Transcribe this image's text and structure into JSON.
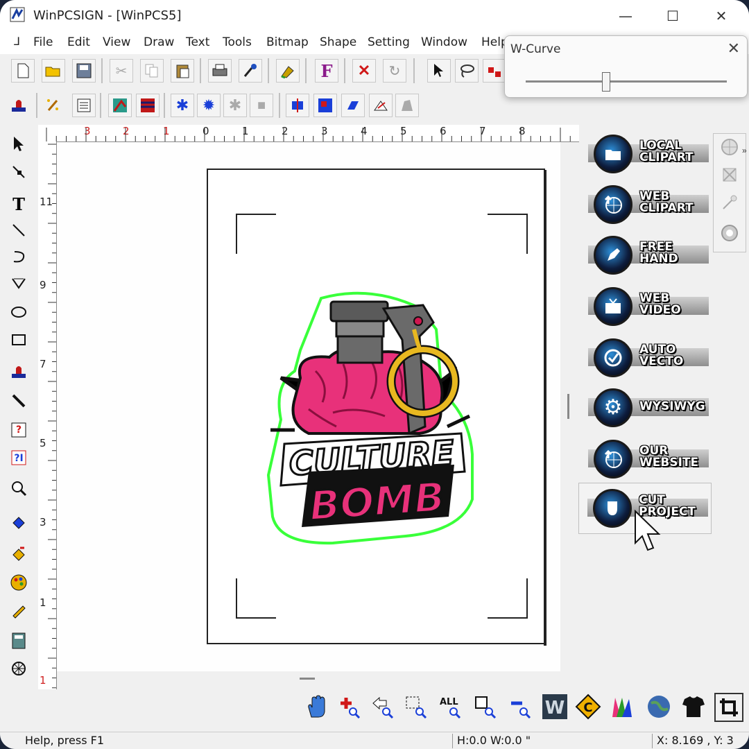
{
  "window": {
    "title": "WinPCSIGN - [WinPCS5]",
    "controls": {
      "minimize": "—",
      "maximize": "☐",
      "close": "✕"
    }
  },
  "menu": {
    "items": [
      "File",
      "Edit",
      "View",
      "Draw",
      "Text",
      "Tools",
      "Bitmap",
      "Shape",
      "Setting",
      "Window",
      "Help"
    ]
  },
  "wcurve": {
    "title": "W-Curve",
    "close": "✕",
    "slider_value": 0.4
  },
  "ruler": {
    "h_labels": [
      "3",
      "2",
      "1",
      "0",
      "1",
      "2",
      "3",
      "4",
      "5",
      "6",
      "7",
      "8"
    ],
    "v_labels": [
      "11",
      "9",
      "7",
      "5",
      "3",
      "1",
      "1"
    ]
  },
  "panel": {
    "buttons": [
      {
        "label": "LOCAL\nCLIPART",
        "icon": "folder-icon"
      },
      {
        "label": "WEB\nCLIPART",
        "icon": "globe-upload-icon"
      },
      {
        "label": "FREE\nHAND",
        "icon": "pen-nib-icon"
      },
      {
        "label": "WEB\nVIDEO",
        "icon": "tv-icon"
      },
      {
        "label": "AUTO\nVECTO",
        "icon": "checkmark-icon"
      },
      {
        "label": "WYSIWYG",
        "icon": "gear-icon"
      },
      {
        "label": "OUR\nWEBSITE",
        "icon": "globe-upload-icon"
      },
      {
        "label": "CUT\nPROJECT",
        "icon": "cutter-icon"
      }
    ]
  },
  "status": {
    "help": "Help, press F1",
    "hw": "H:0.0   W:0.0 \"",
    "coords": "X: 8.169 , Y: 3"
  },
  "colors": {
    "accent_blue": "#2e8fd8",
    "sticker_outline": "#39ff3a",
    "brain_pink": "#e8317a",
    "ruler_red": "#d02020"
  }
}
